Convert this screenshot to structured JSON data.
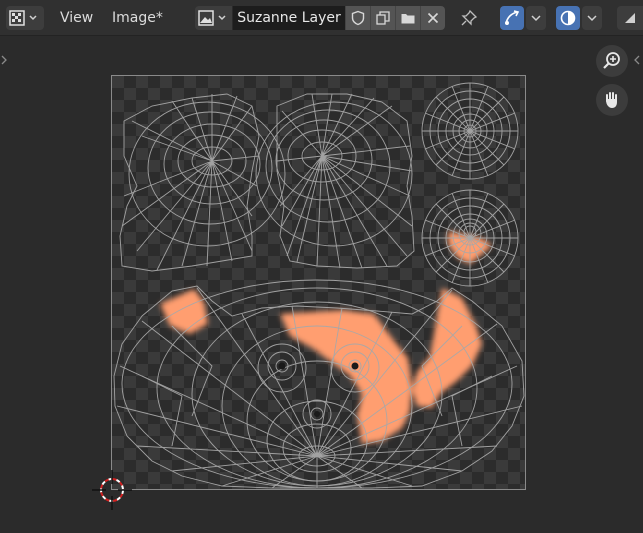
{
  "header": {
    "menu_view": "View",
    "menu_image": "Image*",
    "image_name": "Suzanne Layer"
  },
  "icons": {
    "editor_type": "image-editor-icon",
    "image_type": "image-icon",
    "fake_user": "shield-icon",
    "duplicate": "duplicate-icon",
    "open": "folder-icon",
    "unlink": "close-icon",
    "pin": "pin-icon",
    "uv_sync": "uv-sync-icon",
    "overlay": "overlay-icon",
    "zoom": "zoom-icon",
    "pan": "hand-icon",
    "cursor": "3d-cursor-icon"
  },
  "colors": {
    "accent": "#4772b3",
    "paint": "#ff9e70",
    "wire": "#a8a8a8"
  }
}
